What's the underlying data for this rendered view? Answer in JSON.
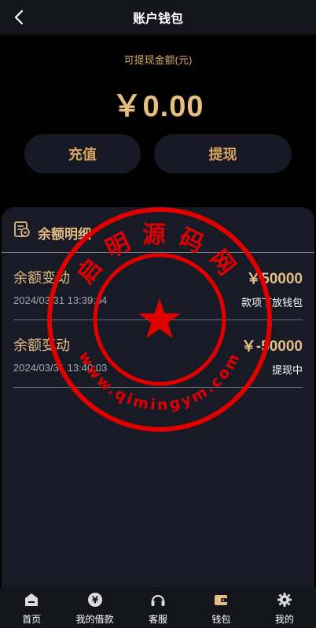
{
  "header": {
    "title": "账户钱包",
    "back_icon": "chevron-left-icon"
  },
  "balance": {
    "label": "可提现金额(元)",
    "amount": "￥0.00"
  },
  "actions": {
    "recharge_label": "充值",
    "withdraw_label": "提现"
  },
  "details": {
    "title": "余额明细",
    "icon": "ledger-icon",
    "records": [
      {
        "type": "余额变动",
        "amount": "￥50000",
        "time": "2024/03/31 13:39:04",
        "status": "款项下放钱包"
      },
      {
        "type": "余额变动",
        "amount": "￥-50000",
        "time": "2024/03/31 13:40:03",
        "status": "提现中"
      }
    ]
  },
  "tabbar": {
    "items": [
      {
        "label": "首页",
        "icon": "home-icon"
      },
      {
        "label": "我的借款",
        "icon": "yen-coin-icon"
      },
      {
        "label": "客服",
        "icon": "headset-icon"
      },
      {
        "label": "钱包",
        "icon": "wallet-icon",
        "active": true
      },
      {
        "label": "我的",
        "icon": "gear-icon"
      }
    ]
  },
  "watermark": {
    "text_top": "启明源码网",
    "text_bottom": "www.qimingym.com"
  },
  "colors": {
    "accent_gold": "#e3bd84",
    "background": "#000000",
    "panel": "#181b26",
    "button": "#171a26",
    "stamp_red": "#e00000"
  }
}
